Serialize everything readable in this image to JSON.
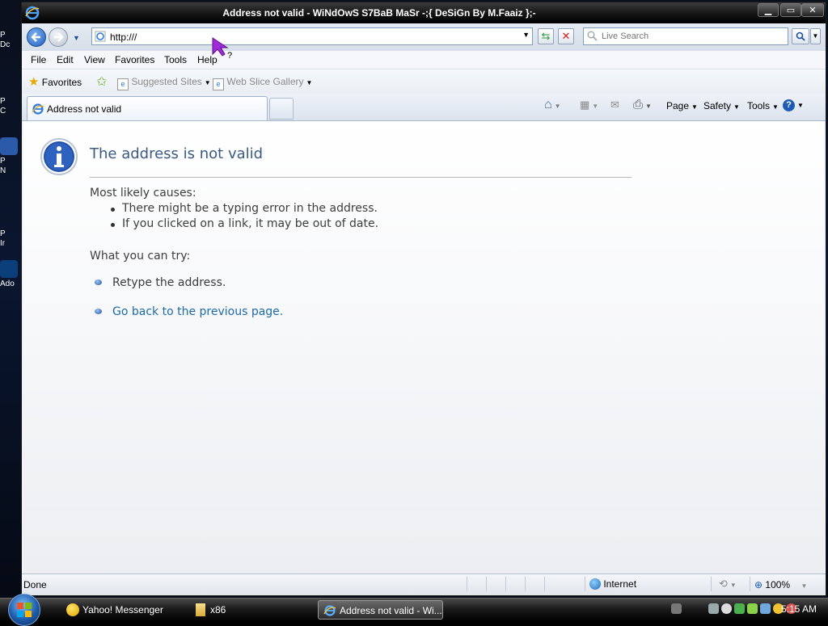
{
  "window": {
    "title": "Address not valid - WiNdOwS S7BaB MaSr -;{ DeSiGn By M.Faaiz };-"
  },
  "desktop": {
    "icons": [
      {
        "label": "P\nDc"
      },
      {
        "label": "P\nC"
      },
      {
        "label": "P\nN"
      },
      {
        "label": "P\nIr"
      },
      {
        "label": "Ado"
      }
    ]
  },
  "navbar": {
    "address": "http:///",
    "search_placeholder": "Live Search"
  },
  "menu": [
    "File",
    "Edit",
    "View",
    "Favorites",
    "Tools",
    "Help"
  ],
  "favorites_bar": {
    "favorites_label": "Favorites",
    "suggested_sites": "Suggested Sites",
    "web_slice_gallery": "Web Slice Gallery"
  },
  "tab": {
    "label": "Address not valid"
  },
  "command_bar": {
    "page": "Page",
    "safety": "Safety",
    "tools": "Tools"
  },
  "content": {
    "title": "The address is not valid",
    "causes_heading": "Most likely causes:",
    "causes": [
      "There might be a typing error in the address.",
      "If you clicked on a link, it may be out of date."
    ],
    "try_heading": "What you can try:",
    "try_retype": "Retype the address.",
    "try_goback": "Go back to the previous page."
  },
  "status": {
    "text": "Done",
    "zone": "Internet",
    "zoom": "100%"
  },
  "taskbar": {
    "items": [
      "Yahoo! Messenger",
      "x86",
      "Address not valid - Wi..."
    ],
    "clock": "5:15 AM"
  },
  "colors": {
    "title_blue": "#3a5a82",
    "link_blue": "#1c6aa6"
  }
}
